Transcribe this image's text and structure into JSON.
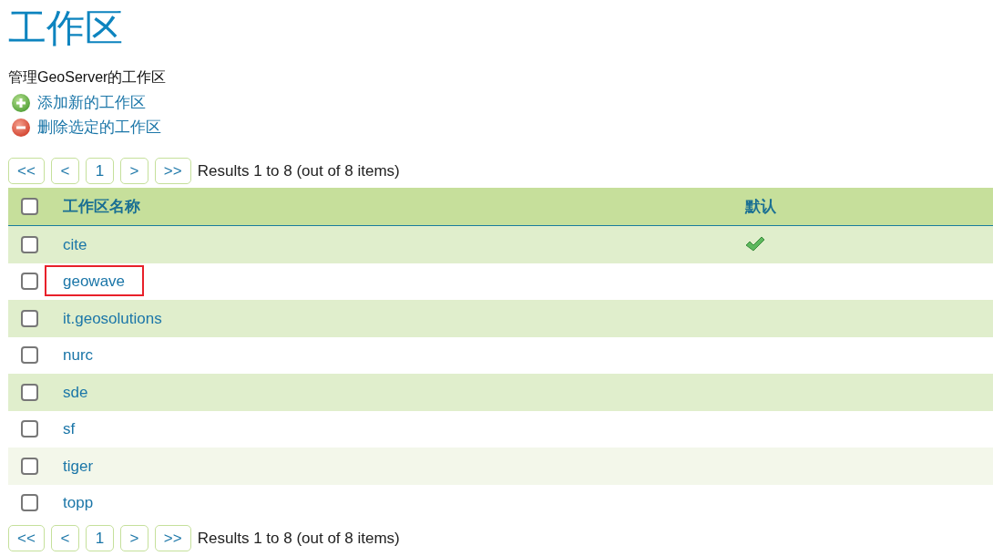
{
  "page": {
    "title": "工作区",
    "description": "管理GeoServer的工作区"
  },
  "actions": [
    {
      "kind": "add",
      "label": "添加新的工作区"
    },
    {
      "kind": "remove",
      "label": "删除选定的工作区"
    }
  ],
  "pager_top": {
    "buttons": [
      "<<",
      "<",
      "1",
      ">",
      ">>"
    ],
    "summary": "Results 1 to 8 (out of 8 items)"
  },
  "table": {
    "select_all": {
      "checked": false
    },
    "columns": [
      "工作区名称",
      "默认"
    ],
    "rows": [
      {
        "name": "cite",
        "default": true,
        "checked": false,
        "hovered": false,
        "outlined": false
      },
      {
        "name": "geowave",
        "default": false,
        "checked": false,
        "hovered": false,
        "outlined": true
      },
      {
        "name": "it.geosolutions",
        "default": false,
        "checked": false,
        "hovered": false,
        "outlined": false
      },
      {
        "name": "nurc",
        "default": false,
        "checked": false,
        "hovered": false,
        "outlined": false
      },
      {
        "name": "sde",
        "default": false,
        "checked": false,
        "hovered": false,
        "outlined": false
      },
      {
        "name": "sf",
        "default": false,
        "checked": false,
        "hovered": false,
        "outlined": false
      },
      {
        "name": "tiger",
        "default": false,
        "checked": false,
        "hovered": true,
        "outlined": false
      },
      {
        "name": "topp",
        "default": false,
        "checked": false,
        "hovered": false,
        "outlined": false
      }
    ]
  },
  "pager_bottom": {
    "buttons": [
      "<<",
      "<",
      "1",
      ">",
      ">>"
    ],
    "summary": "Results 1 to 8 (out of 8 items)"
  }
}
